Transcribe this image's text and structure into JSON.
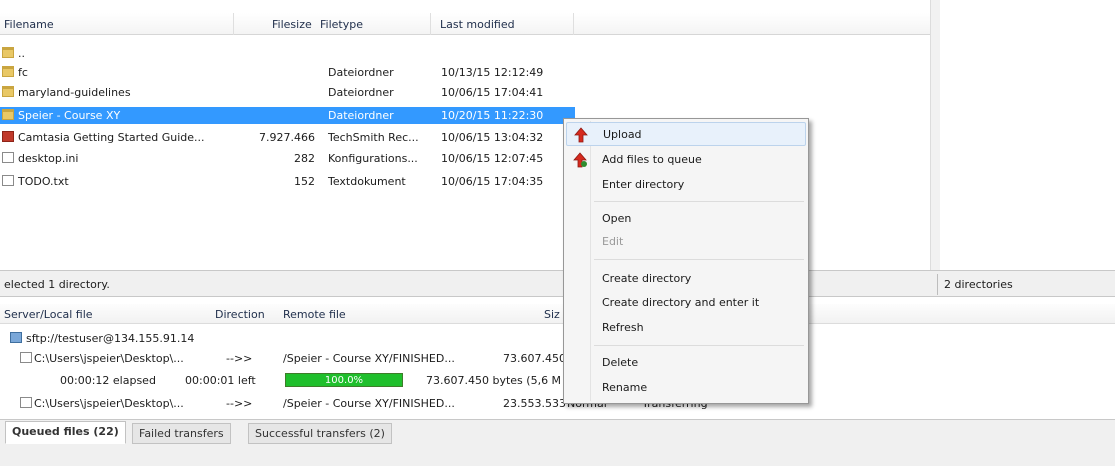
{
  "file_list": {
    "columns": {
      "name": "Filename",
      "size": "Filesize",
      "type": "Filetype",
      "modified": "Last modified"
    },
    "rows": [
      {
        "name": "..",
        "size": "",
        "type": "",
        "modified": "",
        "icon": "folder-icon"
      },
      {
        "name": "fc",
        "size": "",
        "type": "Dateiordner",
        "modified": "10/13/15 12:12:49",
        "icon": "folder-icon"
      },
      {
        "name": "maryland-guidelines",
        "size": "",
        "type": "Dateiordner",
        "modified": "10/06/15 17:04:41",
        "icon": "folder-icon"
      },
      {
        "name": "Speier - Course XY",
        "size": "",
        "type": "Dateiordner",
        "modified": "10/20/15 11:22:30",
        "icon": "folder-icon",
        "selected": true
      },
      {
        "name": "Camtasia Getting Started Guide...",
        "size": "7.927.466",
        "type": "TechSmith Rec...",
        "modified": "10/06/15 13:04:32",
        "icon": "camtasia-file-icon"
      },
      {
        "name": "desktop.ini",
        "size": "282",
        "type": "Konfigurations...",
        "modified": "10/06/15 12:07:45",
        "icon": "settings-file-icon"
      },
      {
        "name": "TODO.txt",
        "size": "152",
        "type": "Textdokument",
        "modified": "10/06/15 17:04:35",
        "icon": "text-file-icon"
      }
    ]
  },
  "status": {
    "left": "elected 1 directory.",
    "right": "2 directories"
  },
  "queue": {
    "columns": {
      "server": "Server/Local file",
      "direction": "Direction",
      "remote": "Remote file",
      "size": "Siz"
    },
    "server_row": "sftp://testuser@134.155.91.14",
    "rows": [
      {
        "local": "C:\\Users\\jspeier\\Desktop\\...",
        "direction": "-->>",
        "remote": "/Speier - Course XY/FINISHED...",
        "size": "73.607.450"
      },
      {
        "local": "C:\\Users\\jspeier\\Desktop\\...",
        "direction": "-->>",
        "remote": "/Speier - Course XY/FINISHED...",
        "size": "23.553.533",
        "priority": "Normal",
        "status": "Transferring"
      }
    ],
    "progress_row": {
      "elapsed": "00:00:12 elapsed",
      "left": "00:00:01 left",
      "percent_text": "100.0%",
      "percent": 100,
      "bytes": "73.607.450 bytes (5,6 M"
    }
  },
  "tabs": [
    {
      "label": "Queued files (22)",
      "active": true
    },
    {
      "label": "Failed transfers",
      "active": false
    },
    {
      "label": "Successful transfers (2)",
      "active": false
    }
  ],
  "context_menu": {
    "items": [
      {
        "label": "Upload",
        "icon": "upload-arrow-icon",
        "hover": true
      },
      {
        "label": "Add files to queue",
        "icon": "add-to-queue-icon"
      },
      {
        "label": "Enter directory"
      },
      {
        "label": "Open"
      },
      {
        "label": "Edit",
        "disabled": true
      },
      {
        "label": "Create directory"
      },
      {
        "label": "Create directory and enter it"
      },
      {
        "label": "Refresh"
      },
      {
        "label": "Delete"
      },
      {
        "label": "Rename"
      }
    ]
  },
  "colors": {
    "selection": "#3399ff",
    "progress": "#1fbf2c",
    "upload_arrow": "#d62a1e",
    "queue_arrow": "#2e8b2e"
  }
}
